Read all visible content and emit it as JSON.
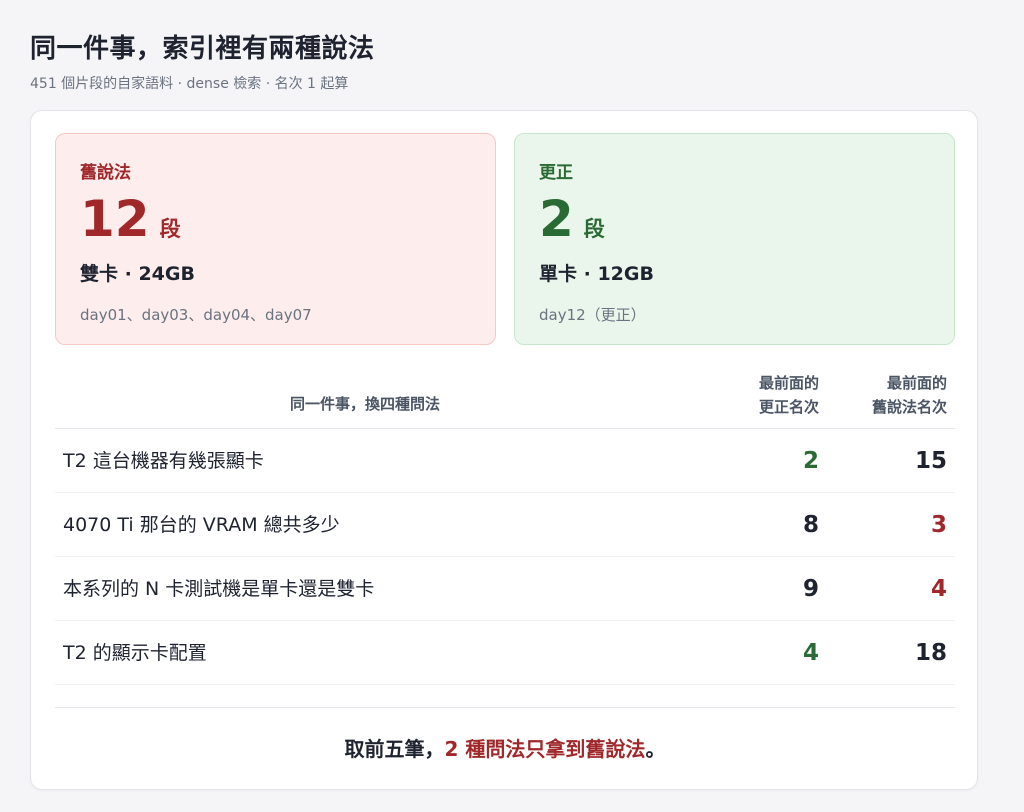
{
  "header": {
    "title": "同一件事，索引裡有兩種說法",
    "subtitle": "451 個片段的自家語料 · dense 檢索 · 名次 1 起算"
  },
  "old_panel": {
    "label": "舊說法",
    "count": "12",
    "unit": "段",
    "spec": "雙卡 · 24GB",
    "days": "day01、day03、day04、day07"
  },
  "new_panel": {
    "label": "更正",
    "count": "2",
    "unit": "段",
    "spec": "單卡 · 12GB",
    "days": "day12（更正）"
  },
  "table": {
    "col_query": "同一件事，換四種問法",
    "col_new_line1": "最前面的",
    "col_new_line2": "更正名次",
    "col_old_line1": "最前面的",
    "col_old_line2": "舊說法名次",
    "rows": [
      {
        "query": "T2 這台機器有幾張顯卡",
        "new_rank": "2",
        "old_rank": "15",
        "winner": "new"
      },
      {
        "query": "4070 Ti 那台的 VRAM 總共多少",
        "new_rank": "8",
        "old_rank": "3",
        "winner": "old"
      },
      {
        "query": "本系列的 N 卡測試機是單卡還是雙卡",
        "new_rank": "9",
        "old_rank": "4",
        "winner": "old"
      },
      {
        "query": "T2 的顯示卡配置",
        "new_rank": "4",
        "old_rank": "18",
        "winner": "new"
      }
    ]
  },
  "footer": {
    "prefix": "取前五筆，",
    "highlight": "2 種問法只拿到舊說法",
    "suffix": "。"
  },
  "colors": {
    "old_accent": "#a0282a",
    "new_accent": "#2a6b35"
  }
}
